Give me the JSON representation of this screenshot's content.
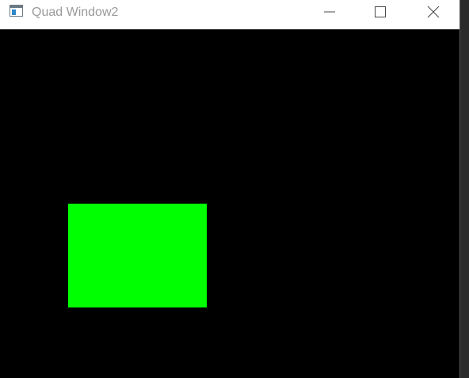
{
  "window": {
    "title": "Quad Window2",
    "icon": "app-window-icon"
  },
  "caption_buttons": {
    "minimize_icon": "minimize-icon",
    "maximize_icon": "maximize-icon",
    "close_icon": "close-icon"
  },
  "colors": {
    "titlebar_background": "#ffffff",
    "title_text": "#9a9a9a",
    "viewport_background": "#000000",
    "quad_fill": "#00ff00"
  }
}
